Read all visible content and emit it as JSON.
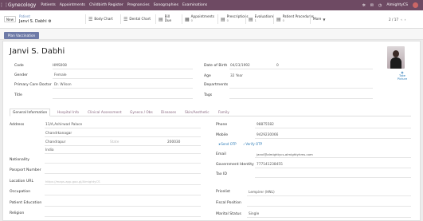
{
  "navbar": {
    "app_name": "Gynecology",
    "menu": [
      "Patients",
      "Appointments",
      "Childbirth Register",
      "Pregnancies",
      "Sonographies",
      "Examinations"
    ],
    "company": "AlmightyCS"
  },
  "control_panel": {
    "new_label": "New",
    "breadcrumb_parent": "Patient",
    "breadcrumb_current": "Janvi S. Dabhi",
    "stats": [
      {
        "icon": "body-chart-icon",
        "label": "Body Chart"
      },
      {
        "icon": "dental-chart-icon",
        "label": "Dental Chart"
      },
      {
        "icon": "billing-icon",
        "label": "Bill",
        "sub": "Due"
      },
      {
        "icon": "appointments-icon",
        "label": "Appointments",
        "sub": "0"
      },
      {
        "icon": "prescriptions-icon",
        "label": "Prescriptions",
        "sub": "0"
      },
      {
        "icon": "evaluations-icon",
        "label": "Evaluations",
        "sub": "1"
      },
      {
        "icon": "procedures-icon",
        "label": "Patient Procedures",
        "sub": "0"
      },
      {
        "icon": "chevron-down-icon",
        "label": "More"
      }
    ],
    "pager": "2 / 17"
  },
  "button_bar": {
    "plan_vaccination": "Plan Vaccination"
  },
  "patient": {
    "name": "Janvi S. Dabhi",
    "take_picture": "Take Picture",
    "code_label": "Code",
    "code": "HMS008",
    "gender_label": "Gender",
    "gender": "Female",
    "pcd_label": "Primary Care Doctor",
    "pcd": "Dr. Wilson",
    "title_label": "Title",
    "dob_label": "Date of Birth",
    "dob": "04/23/1992",
    "dob_extra": "0",
    "age_label": "Age",
    "age": "32 Year",
    "departments_label": "Departments",
    "tags_label": "Tags"
  },
  "tabs": [
    "General Information",
    "Hospital Info",
    "Clinical Assessment",
    "Gyneco / Obs",
    "Diseases",
    "Skin/Aesthetic",
    "Family"
  ],
  "general": {
    "address_label": "Address",
    "street": "11/A,Ashirwad Palace",
    "street2": "Chandrkanagar",
    "city": "Chandrapur",
    "state_placeholder": "State",
    "zip": "200030",
    "country": "India",
    "nationality_label": "Nationality",
    "passport_label": "Passport Number",
    "location_label": "Location URL",
    "location_placeholder": "https://maps.app.goo.gl/AlmightyCS",
    "occupation_label": "Occupation",
    "education_label": "Patient Education",
    "religion_label": "Religion",
    "phone_label": "Phone",
    "phone": "98875582",
    "mobile_label": "Mobile",
    "mobile": "9429230066",
    "send_otp": "Send OTP",
    "verify_otp": "Verify OTP",
    "email_label": "Email",
    "email": "janvi@almightycs-almightyhms.com",
    "gov_id_label": "Government Identity",
    "gov_id": "777141238455",
    "tax_id_label": "Tax ID",
    "pricelist_label": "Pricelist",
    "pricelist": "Lempirer (HNL)",
    "fiscal_label": "Fiscal Position",
    "marital_label": "Marital Status",
    "marital": "Single"
  }
}
